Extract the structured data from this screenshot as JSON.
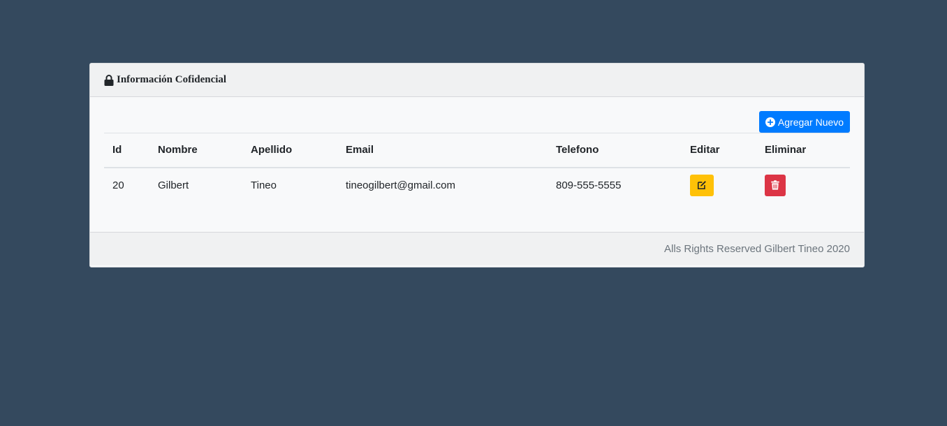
{
  "card": {
    "title": "Información Cofidencial",
    "title_icon": "lock-icon",
    "add_button": {
      "label": "Agregar Nuevo",
      "icon": "plus-circle-icon",
      "color": "#007bff"
    },
    "table": {
      "columns": [
        "Id",
        "Nombre",
        "Apellido",
        "Email",
        "Telefono",
        "Editar",
        "Eliminar"
      ],
      "rows": [
        {
          "id": "20",
          "nombre": "Gilbert",
          "apellido": "Tineo",
          "email": "tineogilbert@gmail.com",
          "telefono": "809-555-5555",
          "edit_icon": "edit-icon",
          "delete_icon": "trash-icon"
        }
      ]
    },
    "footer": "Alls Rights Reserved Gilbert Tineo 2020"
  },
  "colors": {
    "background": "#34495e",
    "edit": "#ffc107",
    "delete": "#dc3545",
    "primary": "#007bff"
  }
}
